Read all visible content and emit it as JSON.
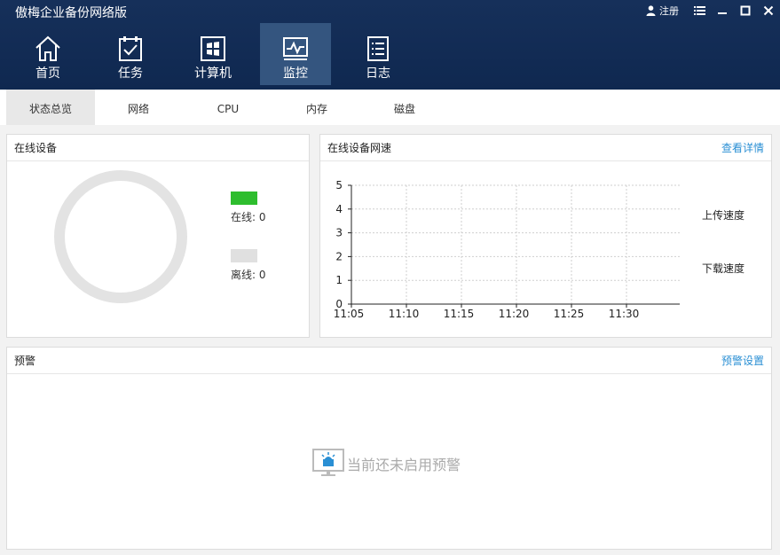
{
  "app": {
    "title": "傲梅企业备份网络版",
    "login": "注册"
  },
  "nav": [
    {
      "label": "首页",
      "icon": "home-icon"
    },
    {
      "label": "任务",
      "icon": "task-icon"
    },
    {
      "label": "计算机",
      "icon": "computer-icon"
    },
    {
      "label": "监控",
      "icon": "monitor-icon"
    },
    {
      "label": "日志",
      "icon": "log-icon"
    }
  ],
  "nav_active": "监控",
  "subtabs": [
    "状态总览",
    "网络",
    "CPU",
    "内存",
    "磁盘"
  ],
  "subtab_active": "状态总览",
  "online_devices": {
    "title": "在线设备",
    "online_label": "在线: 0",
    "offline_label": "离线: 0",
    "online_color": "#2ebd2e",
    "offline_color": "#e0e0e0",
    "ring_color": "#e3e3e3"
  },
  "network_speed": {
    "title": "在线设备网速",
    "link": "查看详情",
    "upload_label": "上传速度",
    "download_label": "下载速度"
  },
  "chart_data": {
    "type": "line",
    "x": [
      "11:05",
      "11:10",
      "11:15",
      "11:20",
      "11:25",
      "11:30"
    ],
    "yticks": [
      0,
      1,
      2,
      3,
      4,
      5
    ],
    "ylim": [
      0,
      5
    ],
    "series": [
      {
        "name": "上传速度",
        "values": []
      },
      {
        "name": "下载速度",
        "values": []
      }
    ],
    "grid": true
  },
  "alert": {
    "title": "预警",
    "link": "预警设置",
    "empty_message": "当前还未启用预警"
  }
}
